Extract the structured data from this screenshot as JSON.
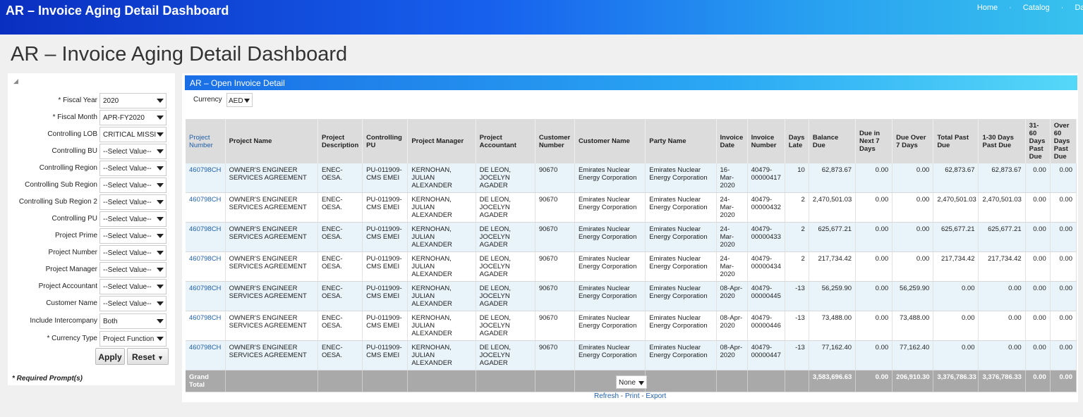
{
  "app": {
    "title": "AR – Invoice Aging Detail Dashboard"
  },
  "topnav": {
    "items": [
      "Home",
      "Catalog",
      "Das"
    ]
  },
  "page_title": "AR – Invoice Aging Detail Dashboard",
  "prompts": {
    "fields": [
      {
        "label": "* Fiscal Year",
        "value": "2020"
      },
      {
        "label": "* Fiscal Month",
        "value": "APR-FY2020"
      },
      {
        "label": "Controlling LOB",
        "value": "CRITICAL MISSI"
      },
      {
        "label": "Controlling BU",
        "value": "--Select Value--"
      },
      {
        "label": "Controlling Region",
        "value": "--Select Value--"
      },
      {
        "label": "Controlling Sub Region",
        "value": "--Select Value--"
      },
      {
        "label": "Controlling Sub Region 2",
        "value": "--Select Value--"
      },
      {
        "label": "Controlling PU",
        "value": "--Select Value--"
      },
      {
        "label": "Project Prime",
        "value": "--Select Value--"
      },
      {
        "label": "Project Number",
        "value": "--Select Value--"
      },
      {
        "label": "Project Manager",
        "value": "--Select Value--"
      },
      {
        "label": "Project Accountant",
        "value": "--Select Value--"
      },
      {
        "label": "Customer Name",
        "value": "--Select Value--"
      },
      {
        "label": "Include Intercompany",
        "value": "Both"
      },
      {
        "label": "* Currency Type",
        "value": "Project Function"
      }
    ],
    "apply_label": "Apply",
    "reset_label": "Reset",
    "required_note": "* Required Prompt(s)"
  },
  "report": {
    "section_title": "AR – Open Invoice Detail",
    "currency_label": "Currency",
    "currency_value": "AED",
    "columns": [
      "Project Number",
      "Project Name",
      "Project Description",
      "Controlling PU",
      "Project Manager",
      "Project Accountant",
      "Customer Number",
      "Customer Name",
      "Party Name",
      "Invoice Date",
      "Invoice Number",
      "Days Late",
      "Balance Due",
      "Due in Next 7 Days",
      "Due Over 7 Days",
      "Total Past Due",
      "1-30 Days Past Due",
      "31-60 Days Past Due",
      "Over 60 Days Past Due"
    ],
    "rows": [
      [
        "460798CH",
        "OWNER'S ENGINEER SERVICES AGREEMENT",
        "ENEC-OESA.",
        "PU-011909-CMS EMEI",
        "KERNOHAN, JULIAN ALEXANDER",
        "DE LEON, JOCELYN AGADER",
        "90670",
        "Emirates Nuclear Energy Corporation",
        "Emirates Nuclear Energy Corporation",
        "16-Mar-2020",
        "40479-00000417",
        "10",
        "62,873.67",
        "0.00",
        "0.00",
        "62,873.67",
        "62,873.67",
        "0.00",
        "0.00"
      ],
      [
        "460798CH",
        "OWNER'S ENGINEER SERVICES AGREEMENT",
        "ENEC-OESA.",
        "PU-011909-CMS EMEI",
        "KERNOHAN, JULIAN ALEXANDER",
        "DE LEON, JOCELYN AGADER",
        "90670",
        "Emirates Nuclear Energy Corporation",
        "Emirates Nuclear Energy Corporation",
        "24-Mar-2020",
        "40479-00000432",
        "2",
        "2,470,501.03",
        "0.00",
        "0.00",
        "2,470,501.03",
        "2,470,501.03",
        "0.00",
        "0.00"
      ],
      [
        "460798CH",
        "OWNER'S ENGINEER SERVICES AGREEMENT",
        "ENEC-OESA.",
        "PU-011909-CMS EMEI",
        "KERNOHAN, JULIAN ALEXANDER",
        "DE LEON, JOCELYN AGADER",
        "90670",
        "Emirates Nuclear Energy Corporation",
        "Emirates Nuclear Energy Corporation",
        "24-Mar-2020",
        "40479-00000433",
        "2",
        "625,677.21",
        "0.00",
        "0.00",
        "625,677.21",
        "625,677.21",
        "0.00",
        "0.00"
      ],
      [
        "460798CH",
        "OWNER'S ENGINEER SERVICES AGREEMENT",
        "ENEC-OESA.",
        "PU-011909-CMS EMEI",
        "KERNOHAN, JULIAN ALEXANDER",
        "DE LEON, JOCELYN AGADER",
        "90670",
        "Emirates Nuclear Energy Corporation",
        "Emirates Nuclear Energy Corporation",
        "24-Mar-2020",
        "40479-00000434",
        "2",
        "217,734.42",
        "0.00",
        "0.00",
        "217,734.42",
        "217,734.42",
        "0.00",
        "0.00"
      ],
      [
        "460798CH",
        "OWNER'S ENGINEER SERVICES AGREEMENT",
        "ENEC-OESA.",
        "PU-011909-CMS EMEI",
        "KERNOHAN, JULIAN ALEXANDER",
        "DE LEON, JOCELYN AGADER",
        "90670",
        "Emirates Nuclear Energy Corporation",
        "Emirates Nuclear Energy Corporation",
        "08-Apr-2020",
        "40479-00000445",
        "-13",
        "56,259.90",
        "0.00",
        "56,259.90",
        "0.00",
        "0.00",
        "0.00",
        "0.00"
      ],
      [
        "460798CH",
        "OWNER'S ENGINEER SERVICES AGREEMENT",
        "ENEC-OESA.",
        "PU-011909-CMS EMEI",
        "KERNOHAN, JULIAN ALEXANDER",
        "DE LEON, JOCELYN AGADER",
        "90670",
        "Emirates Nuclear Energy Corporation",
        "Emirates Nuclear Energy Corporation",
        "08-Apr-2020",
        "40479-00000446",
        "-13",
        "73,488.00",
        "0.00",
        "73,488.00",
        "0.00",
        "0.00",
        "0.00",
        "0.00"
      ],
      [
        "460798CH",
        "OWNER'S ENGINEER SERVICES AGREEMENT",
        "ENEC-OESA.",
        "PU-011909-CMS EMEI",
        "KERNOHAN, JULIAN ALEXANDER",
        "DE LEON, JOCELYN AGADER",
        "90670",
        "Emirates Nuclear Energy Corporation",
        "Emirates Nuclear Energy Corporation",
        "08-Apr-2020",
        "40479-00000447",
        "-13",
        "77,162.40",
        "0.00",
        "77,162.40",
        "0.00",
        "0.00",
        "0.00",
        "0.00"
      ]
    ],
    "grand_total": [
      "Grand Total",
      "",
      "",
      "",
      "",
      "",
      "",
      "",
      "",
      "",
      "",
      "",
      "3,583,696.63",
      "0.00",
      "206,910.30",
      "3,376,786.33",
      "3,376,786.33",
      "0.00",
      "0.00"
    ],
    "view_select_value": "None",
    "links": [
      "Refresh",
      "Print",
      "Export"
    ]
  },
  "colors": {
    "header_gradient_start": "#0a2fc0",
    "link": "#1f5fa8",
    "row_alt": "#e8f3fa",
    "total_bg": "#a9a9a9"
  }
}
